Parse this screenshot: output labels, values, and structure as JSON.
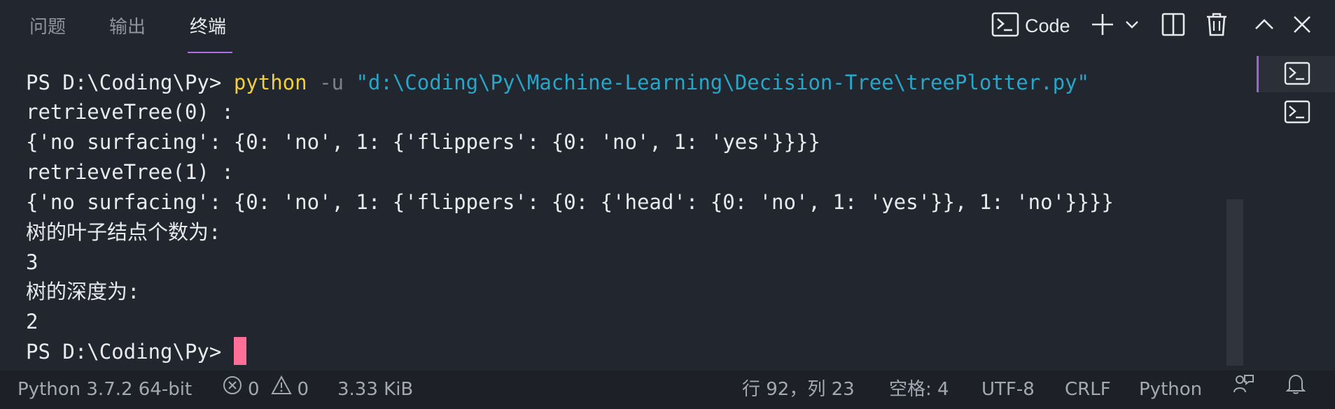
{
  "tabs": {
    "problems": "问题",
    "output": "输出",
    "terminal": "终端"
  },
  "toolbar": {
    "shell_name": "Code"
  },
  "terminal": {
    "prompt": "PS D:\\Coding\\Py>",
    "command": "python",
    "flag": "-u",
    "path": "\"d:\\Coding\\Py\\Machine-Learning\\Decision-Tree\\treePlotter.py\"",
    "output": [
      "retrieveTree(0) :",
      "{'no surfacing': {0: 'no', 1: {'flippers': {0: 'no', 1: 'yes'}}}}",
      "retrieveTree(1) :",
      "{'no surfacing': {0: 'no', 1: {'flippers': {0: {'head': {0: 'no', 1: 'yes'}}, 1: 'no'}}}}",
      "树的叶子结点个数为:",
      "3",
      "树的深度为:",
      "2"
    ],
    "cursor_color": "#ff6f97"
  },
  "statusbar": {
    "interpreter": "Python 3.7.2 64-bit",
    "errors": "0",
    "warnings": "0",
    "file_size": "3.33 KiB",
    "position": "行 92，列 23",
    "indent": "空格: 4",
    "encoding": "UTF-8",
    "eol": "CRLF",
    "language": "Python"
  },
  "colors": {
    "background": "#22262f",
    "accent": "#b06ee0",
    "command": "#f0cf3a",
    "string": "#26a6c8"
  }
}
